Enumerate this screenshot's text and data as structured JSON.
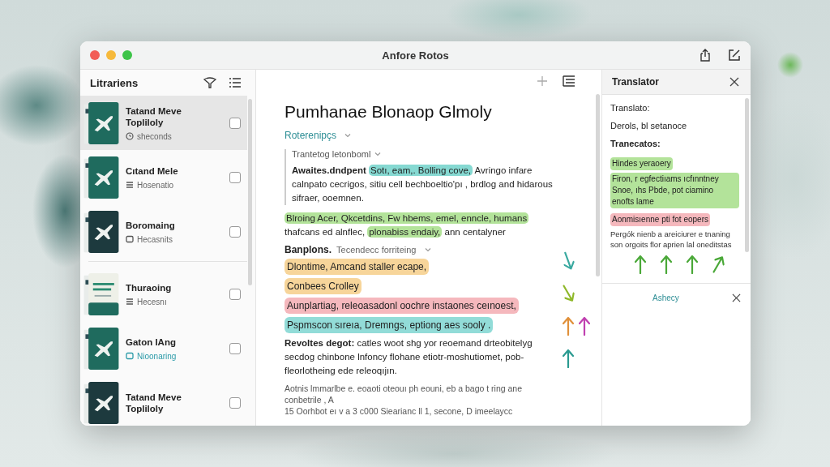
{
  "window": {
    "title": "Anfore Rotos"
  },
  "sidebar": {
    "title": "Litrariens",
    "items": [
      {
        "title": "Tatand Meve Topliloly",
        "status": {
          "kind": "clock",
          "text": "sheconds",
          "accent": false
        },
        "cover": {
          "kind": "green"
        },
        "selected": true,
        "checked": false
      },
      {
        "title": "Cıtand Mele",
        "status": {
          "kind": "list",
          "text": "Hosenatio",
          "accent": false
        },
        "cover": {
          "kind": "green"
        },
        "selected": false,
        "checked": false
      },
      {
        "title": "Boromaing",
        "status": {
          "kind": "box",
          "text": "Hecasnits",
          "accent": false
        },
        "cover": {
          "kind": "dark"
        },
        "selected": false,
        "checked": false
      },
      {
        "title": "Thuraoing",
        "status": {
          "kind": "list",
          "text": "Hecesnı",
          "accent": false
        },
        "cover": {
          "kind": "light"
        },
        "selected": false,
        "checked": false
      },
      {
        "title": "Gaton IAng",
        "status": {
          "kind": "box",
          "text": "Nioonaring",
          "accent": true
        },
        "cover": {
          "kind": "green"
        },
        "selected": false,
        "checked": false
      },
      {
        "title": "Tatand Meve Topliloly",
        "cover": {
          "kind": "dark"
        },
        "selected": false,
        "checked": false
      }
    ]
  },
  "document": {
    "title": "Pumhanae Blonaop Glmoly",
    "link": "Roterenipçs",
    "blocks": [
      {
        "kind": "quote",
        "heading": "Trantetog letonboml",
        "segments": [
          {
            "text": "**Awaites.dndpent** "
          },
          {
            "text": "Sotı, eam,. Bolling cove,",
            "color": "#86d9d2"
          },
          {
            "text": " Avringo infare calnpato cecrigos, sitiu cell bechboeltio'pı , brdlog and hidarous sifraer, ooemnen."
          }
        ]
      },
      {
        "kind": "paragraph",
        "segments": [
          {
            "text": "Blroing Acer, Qkcetdins, Fw hbems, emel, enncle, humans",
            "color": "#b3e39a"
          },
          {
            "text": " thafcans ed alnflec, "
          },
          {
            "text": "plonabiss endaiy,",
            "color": "#b3e39a"
          },
          {
            "text": " ann centalyner"
          }
        ]
      },
      {
        "kind": "term",
        "term": "Banplons.",
        "text": "Tecendecc forriteing"
      },
      {
        "kind": "highlight",
        "text": "Dlontime, Amcand staller ecape,",
        "color": "#f7d59a"
      },
      {
        "kind": "highlight",
        "text": "Conbees Crolley",
        "color": "#f7d59a"
      },
      {
        "kind": "highlight",
        "text": "Aunplartiag, releoasadonl oochre instaones ceınoest,",
        "color": "#f5b8bd"
      },
      {
        "kind": "highlight",
        "text": "Pspmscon sıreıa, Dremngs, eptiong aes sooly .",
        "color": "#92dcd8"
      },
      {
        "kind": "paragraph",
        "segments": [
          {
            "text": "**Revoltes degot:** catles woot shg yor reoemand drteobitelyg secdog chinbone lnfoncy flohane etiotr-moshutiomet, pob-fleorlotheing ede releoqıjın."
          }
        ]
      },
      {
        "kind": "note",
        "text": "Aotnis lmmarlbe e. eoaoti oteouı ph eouni, eb a bago t ring ane conbetrile , A"
      },
      {
        "kind": "note",
        "text": "15 Oorhbot eı v a 3 c000 Siearianc ll 1, secone, D imeelaycc"
      }
    ]
  },
  "translator": {
    "title": "Translator",
    "blocks": [
      {
        "kind": "label",
        "text": "Translato:"
      },
      {
        "kind": "label",
        "text": "Derols, bl setanoce"
      },
      {
        "kind": "heading",
        "text": "Tranecatos:"
      },
      {
        "kind": "highlight",
        "text": "Hindes yeraoery",
        "color": "#b3e39a"
      },
      {
        "kind": "highlight",
        "text": "Firon, r egfectiıams ıcfınntney Snoe, ıhs Pbde, pot ciamino enofts lame",
        "color": "#b3e39a"
      },
      {
        "kind": "highlight",
        "text": "Aonmisıenne pti fot eopers",
        "color": "#f5b8bd"
      },
      {
        "kind": "text",
        "text": "Pergók nienb a areiciurer e tnaning son orgoits flor aprien lal oneditstas"
      }
    ],
    "footer_link": "Ashecy"
  }
}
